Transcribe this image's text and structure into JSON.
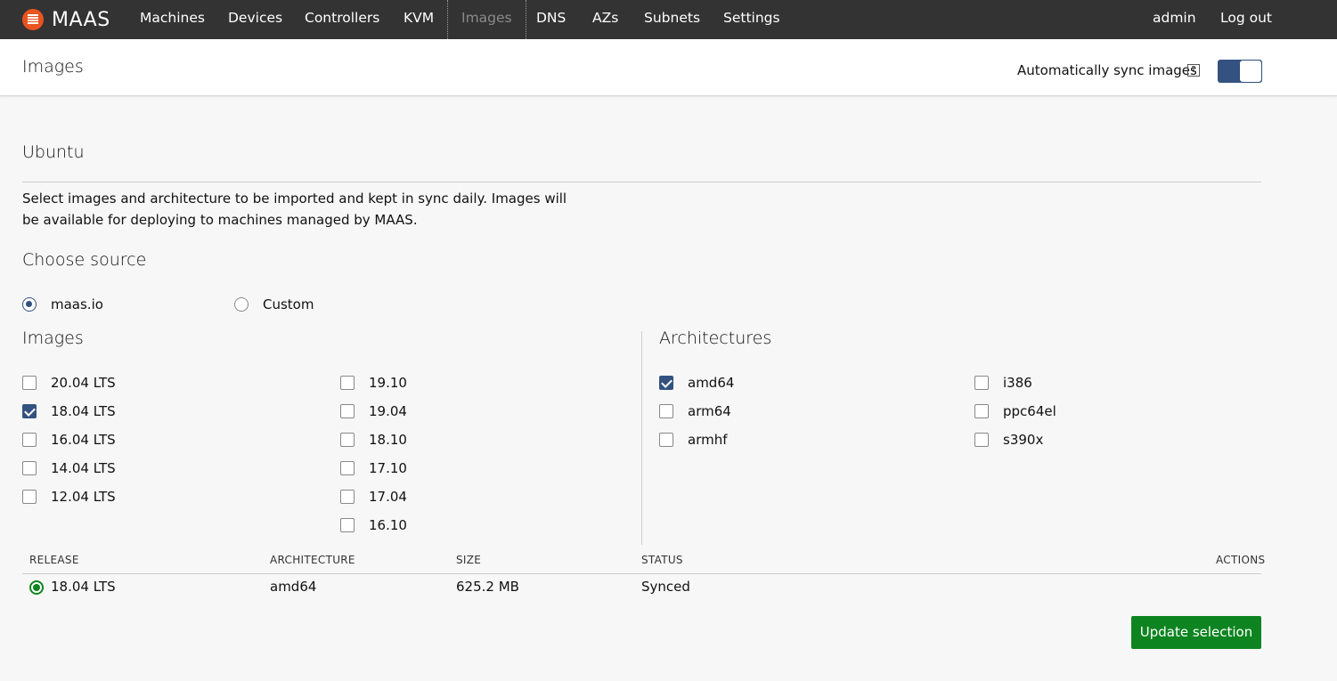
{
  "app": {
    "name": "MAAS"
  },
  "nav": {
    "items": [
      "Machines",
      "Devices",
      "Controllers",
      "KVM",
      "Images",
      "DNS",
      "AZs",
      "Subnets",
      "Settings"
    ],
    "active": "Images",
    "user": "admin",
    "logout": "Log out"
  },
  "header": {
    "title": "Images",
    "sync_label": "Automatically sync images",
    "help": "?",
    "sync_enabled": true
  },
  "ubuntu": {
    "title": "Ubuntu",
    "description": "Select images and architecture to be imported and kept in sync daily. Images will be available for deploying to machines managed by MAAS.",
    "source_title": "Choose source",
    "sources": [
      {
        "label": "maas.io",
        "selected": true
      },
      {
        "label": "Custom",
        "selected": false
      }
    ],
    "images_title": "Images",
    "images_col1": [
      {
        "label": "20.04 LTS",
        "checked": false
      },
      {
        "label": "18.04 LTS",
        "checked": true
      },
      {
        "label": "16.04 LTS",
        "checked": false
      },
      {
        "label": "14.04 LTS",
        "checked": false
      },
      {
        "label": "12.04 LTS",
        "checked": false
      }
    ],
    "images_col2": [
      {
        "label": "19.10",
        "checked": false
      },
      {
        "label": "19.04",
        "checked": false
      },
      {
        "label": "18.10",
        "checked": false
      },
      {
        "label": "17.10",
        "checked": false
      },
      {
        "label": "17.04",
        "checked": false
      },
      {
        "label": "16.10",
        "checked": false
      }
    ],
    "arch_title": "Architectures",
    "arch_col1": [
      {
        "label": "amd64",
        "checked": true
      },
      {
        "label": "arm64",
        "checked": false
      },
      {
        "label": "armhf",
        "checked": false
      }
    ],
    "arch_col2": [
      {
        "label": "i386",
        "checked": false
      },
      {
        "label": "ppc64el",
        "checked": false
      },
      {
        "label": "s390x",
        "checked": false
      }
    ]
  },
  "table": {
    "headers": {
      "release": "RELEASE",
      "architecture": "ARCHITECTURE",
      "size": "SIZE",
      "status": "STATUS",
      "actions": "ACTIONS"
    },
    "rows": [
      {
        "release": "18.04 LTS",
        "architecture": "amd64",
        "size": "625.2 MB",
        "status": "Synced"
      }
    ]
  },
  "actions": {
    "update_label": "Update selection"
  },
  "colors": {
    "nav_bg": "#333333",
    "accent": "#335280",
    "brand": "#e95420",
    "positive": "#0e8420"
  }
}
